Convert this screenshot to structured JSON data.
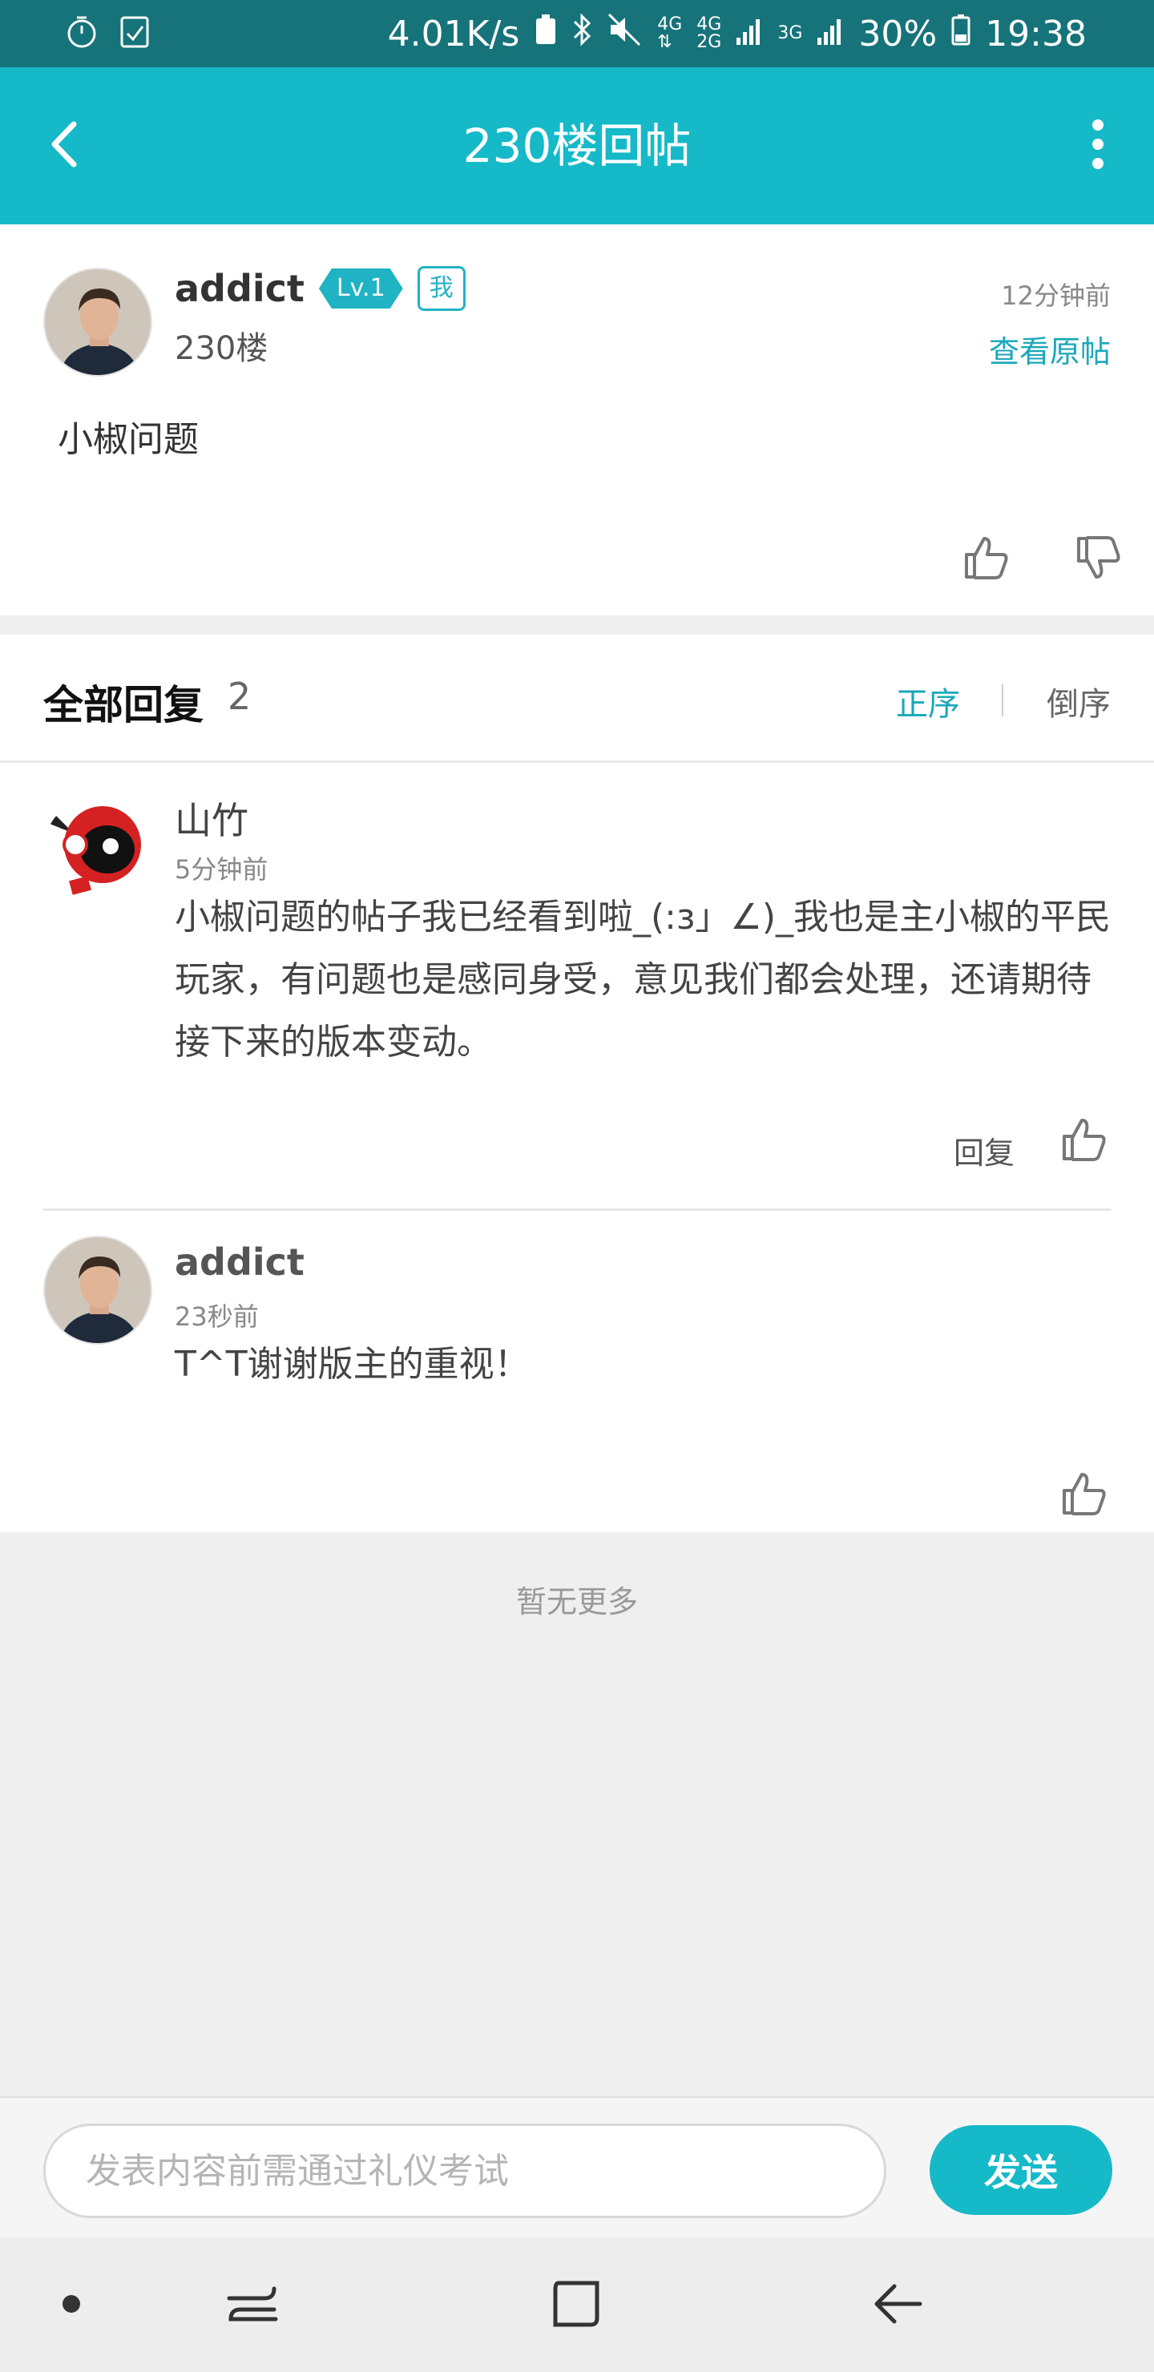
{
  "status_bar": {
    "speed": "4.01K/s",
    "network_a_top": "4G",
    "network_b_top": "4G",
    "network_b_bottom": "2G",
    "network_c": "3G",
    "battery": "30%",
    "time": "19:38",
    "icons": [
      "timer-icon",
      "checklist-icon",
      "recycle-icon",
      "bluetooth-icon",
      "mute-icon",
      "signal-icon",
      "battery-icon"
    ]
  },
  "header": {
    "title": "230楼回帖",
    "back_icon": "chevron-left-icon",
    "more_icon": "more-vertical-icon"
  },
  "post": {
    "username": "addict",
    "level": "Lv.1",
    "me_badge": "我",
    "floor": "230楼",
    "time": "12分钟前",
    "view_original": "查看原帖",
    "body": "小椒问题"
  },
  "replies": {
    "title": "全部回复",
    "count": "2",
    "sort_asc": "正序",
    "sort_desc": "倒序",
    "items": [
      {
        "name": "山竹",
        "time": "5分钟前",
        "body": "小椒问题的帖子我已经看到啦_(:з」∠)_我也是主小椒的平民玩家，有问题也是感同身受，意见我们都会处理，还请期待接下来的版本变动。",
        "reply_label": "回复"
      },
      {
        "name": "addict",
        "time": "23秒前",
        "body": "T^T谢谢版主的重视！"
      }
    ],
    "no_more": "暂无更多"
  },
  "composer": {
    "placeholder": "发表内容前需通过礼仪考试",
    "send_label": "发送"
  },
  "colors": {
    "accent": "#16b9c8",
    "status_bar": "#16737a",
    "link": "#1aa8b9"
  }
}
